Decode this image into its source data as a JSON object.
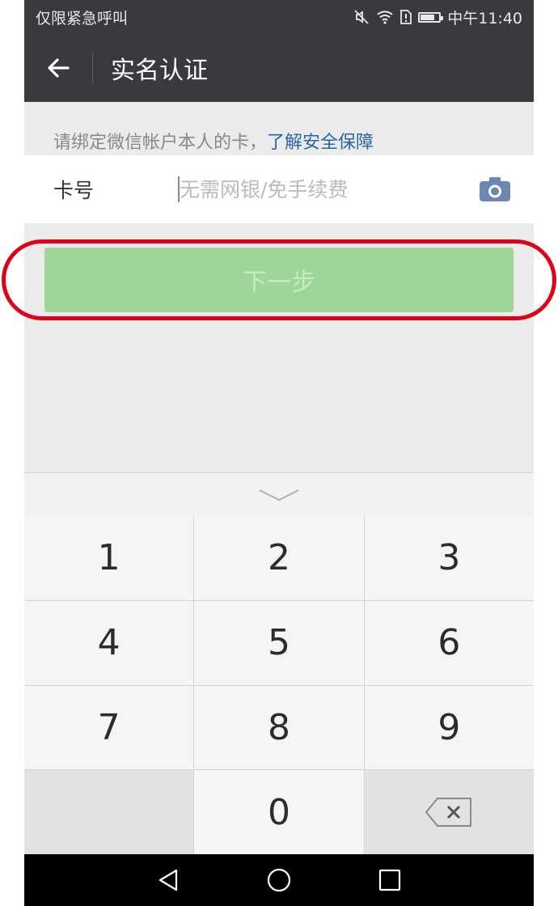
{
  "status_bar": {
    "carrier": "仅限紧急呼叫",
    "time": "中午11:40"
  },
  "header": {
    "title": "实名认证"
  },
  "tip": {
    "text": "请绑定微信帐户本人的卡，",
    "link": "了解安全保障"
  },
  "card": {
    "label": "卡号",
    "placeholder": "无需网银/免手续费",
    "value": ""
  },
  "next_button": {
    "label": "下一步"
  },
  "keypad": {
    "k1": "1",
    "k2": "2",
    "k3": "3",
    "k4": "4",
    "k5": "5",
    "k6": "6",
    "k7": "7",
    "k8": "8",
    "k9": "9",
    "k0": "0"
  },
  "colors": {
    "header": "#393a3f",
    "accent": "#9ed69a",
    "link": "#2a64a6",
    "highlight": "#e00018"
  },
  "icons": [
    "back-arrow-icon",
    "camera-icon",
    "mute-icon",
    "wifi-icon",
    "battery-icon",
    "chevron-down-icon",
    "backspace-icon",
    "nav-back-icon",
    "nav-home-icon",
    "nav-recents-icon"
  ]
}
